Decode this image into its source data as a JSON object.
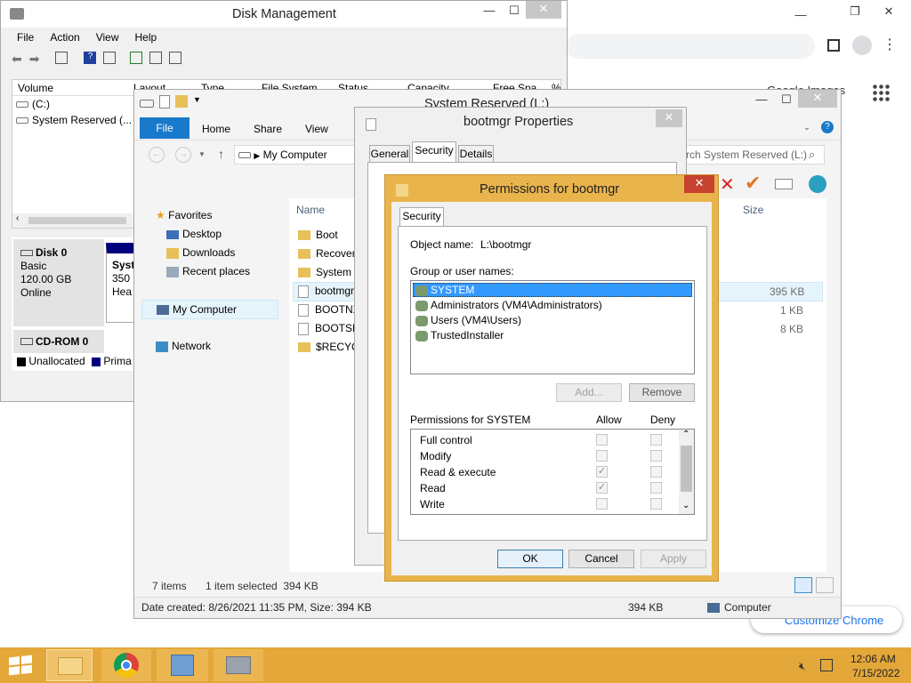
{
  "chrome": {
    "customize_label": "Customize Chrome",
    "partial_label": "Google Images",
    "colors": {
      "bg": "#ffffff",
      "omnibox": "#f1f3f4"
    }
  },
  "disk_mgmt": {
    "title": "Disk Management",
    "menu": [
      "File",
      "Action",
      "View",
      "Help"
    ],
    "columns": [
      "Volume",
      "Layout",
      "Type",
      "File System",
      "Status",
      "Capacity",
      "Free Spa",
      "%"
    ],
    "volumes": [
      {
        "name": "(C:)"
      },
      {
        "name": "System Reserved (..."
      }
    ],
    "disks": [
      {
        "name": "Disk 0",
        "type": "Basic",
        "size": "120.00 GB",
        "status": "Online"
      },
      {
        "name": "CD-ROM 0"
      }
    ],
    "partition": {
      "name": "Syst",
      "size": "350",
      "status": "Hea"
    },
    "legend": [
      {
        "label": "Unallocated",
        "color": "#000000"
      },
      {
        "label": "Prima",
        "color": "#00007f"
      }
    ]
  },
  "explorer": {
    "title": "System Reserved (L:)",
    "ribbon_tabs": [
      "File",
      "Home",
      "Share",
      "View"
    ],
    "path": "My Computer",
    "search_placeholder": "Search System Reserved (L:)",
    "nav": {
      "favorites": "Favorites",
      "desktop": "Desktop",
      "downloads": "Downloads",
      "recent": "Recent places",
      "my_computer": "My Computer",
      "network": "Network"
    },
    "col_name": "Name",
    "col_size": "Size",
    "files": [
      {
        "name": "Boot",
        "size": ""
      },
      {
        "name": "Recovery",
        "size": ""
      },
      {
        "name": "System V",
        "size": ""
      },
      {
        "name": "bootmgr",
        "size": "395 KB"
      },
      {
        "name": "BOOTNX",
        "size": "1 KB"
      },
      {
        "name": "BOOTSE",
        "size": "8 KB"
      },
      {
        "name": "$RECYCL",
        "size": ""
      }
    ],
    "status_items": "7 items",
    "status_selected": "1 item selected  394 KB",
    "details": "Date created: 8/26/2021 11:35 PM, Size: 394 KB",
    "details_size": "394 KB",
    "details_location": "Computer"
  },
  "props": {
    "title": "bootmgr Properties",
    "tabs": [
      "General",
      "Security",
      "Details"
    ]
  },
  "perms": {
    "title": "Permissions for bootmgr",
    "tab": "Security",
    "object_label": "Object name:",
    "object_value": "L:\\bootmgr",
    "group_label": "Group or user names:",
    "groups": [
      "SYSTEM",
      "Administrators (VM4\\Administrators)",
      "Users (VM4\\Users)",
      "TrustedInstaller"
    ],
    "add": "Add...",
    "remove": "Remove",
    "perm_header": "Permissions for SYSTEM",
    "allow": "Allow",
    "deny": "Deny",
    "perms": [
      {
        "name": "Full control",
        "allow": false,
        "deny": false
      },
      {
        "name": "Modify",
        "allow": false,
        "deny": false
      },
      {
        "name": "Read & execute",
        "allow": true,
        "deny": false
      },
      {
        "name": "Read",
        "allow": true,
        "deny": false
      },
      {
        "name": "Write",
        "allow": false,
        "deny": false
      }
    ],
    "ok": "OK",
    "cancel": "Cancel",
    "apply": "Apply"
  },
  "taskbar": {
    "time": "12:06 AM",
    "date": "7/15/2022",
    "color": "#e3a73a"
  }
}
